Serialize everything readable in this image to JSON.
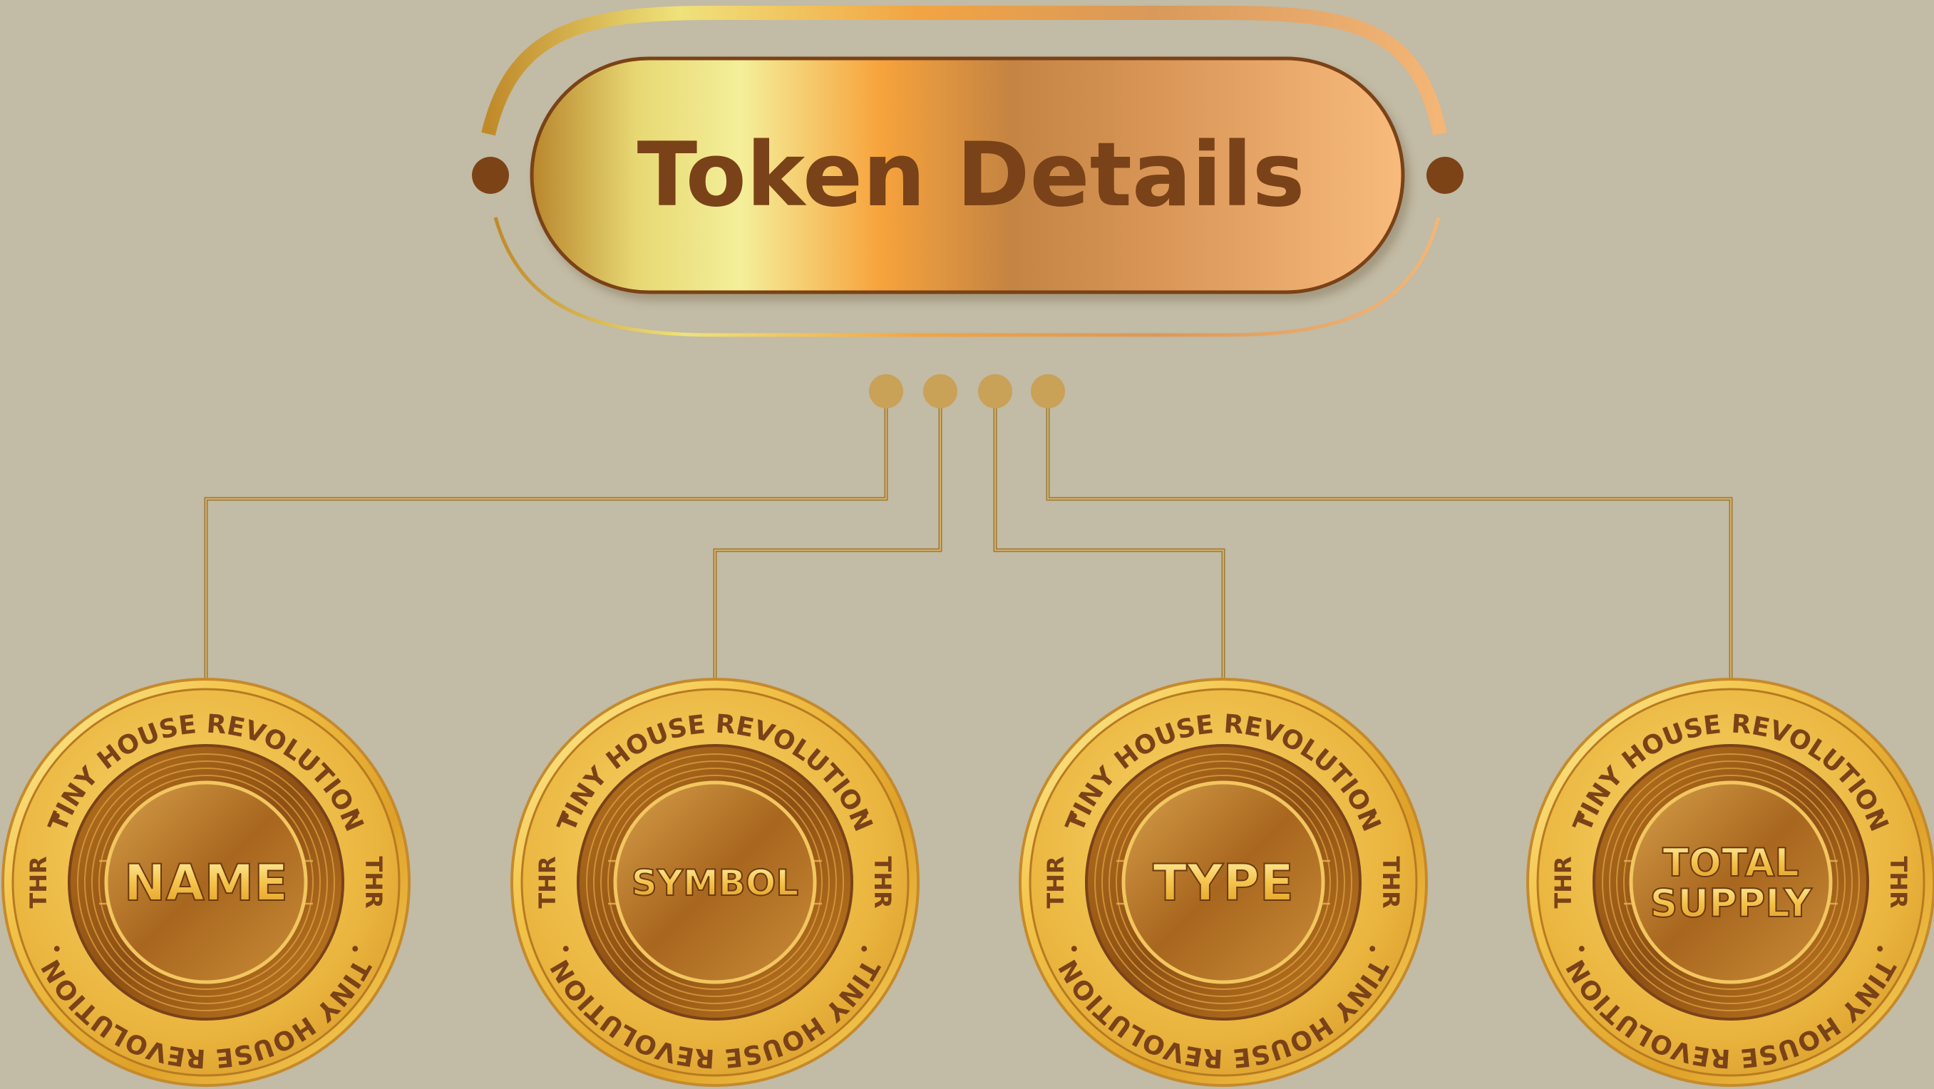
{
  "header": {
    "title": "Token Details"
  },
  "coins": [
    {
      "label_lines": [
        "NAME"
      ],
      "ring_top": "TINY HOUSE REVOLUTION",
      "ring_bottom": "TINY HOUSE REVOLUTION",
      "side_left": "THR",
      "side_right": "THR"
    },
    {
      "label_lines": [
        "SYMBOL"
      ],
      "ring_top": "TINY HOUSE REVOLUTION",
      "ring_bottom": "TINY HOUSE REVOLUTION",
      "side_left": "THR",
      "side_right": "THR"
    },
    {
      "label_lines": [
        "TYPE"
      ],
      "ring_top": "TINY HOUSE REVOLUTION",
      "ring_bottom": "TINY HOUSE REVOLUTION",
      "side_left": "THR",
      "side_right": "THR"
    },
    {
      "label_lines": [
        "TOTAL",
        "SUPPLY"
      ],
      "ring_top": "TINY HOUSE REVOLUTION",
      "ring_bottom": "TINY HOUSE REVOLUTION",
      "side_left": "THR",
      "side_right": "THR"
    }
  ],
  "colors": {
    "background": "#c2bba5",
    "title_text": "#7a4218",
    "connector": "#b8924a",
    "node": "#c9a157",
    "coin_dark": "#8a4e12",
    "coin_light": "#f6d56a"
  }
}
